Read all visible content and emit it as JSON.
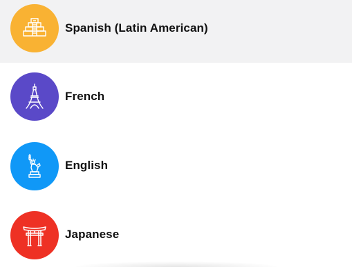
{
  "languages": [
    {
      "label": "Spanish (Latin American)",
      "icon": "pyramid-icon",
      "color": "#f9b233",
      "selected": true
    },
    {
      "label": "French",
      "icon": "eiffel-tower-icon",
      "color": "#5a49c8",
      "selected": false
    },
    {
      "label": "English",
      "icon": "statue-of-liberty-icon",
      "color": "#1098f7",
      "selected": false
    },
    {
      "label": "Japanese",
      "icon": "torii-gate-icon",
      "color": "#ee3124",
      "selected": false
    }
  ]
}
